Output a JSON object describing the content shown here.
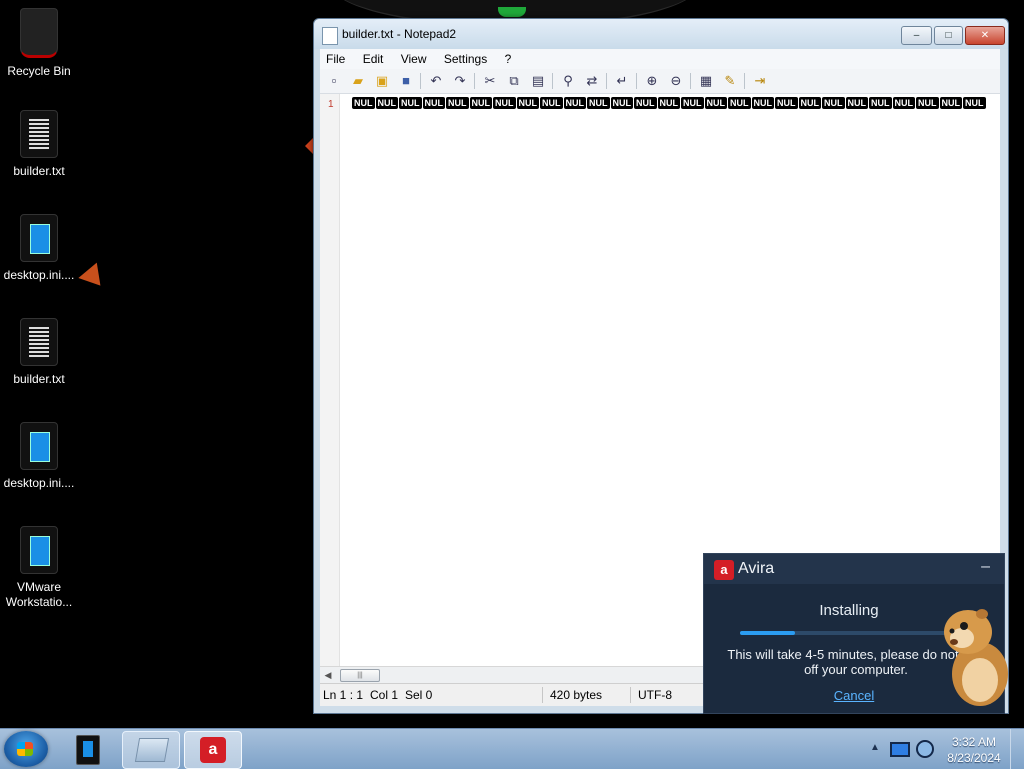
{
  "desktop": {
    "icons": [
      {
        "label": "Recycle Bin"
      },
      {
        "label": "builder.txt"
      },
      {
        "label": "desktop.ini...."
      },
      {
        "label": "builder.txt"
      },
      {
        "label": "desktop.ini...."
      },
      {
        "label": "VMware\nWorkstatio..."
      }
    ]
  },
  "notepad": {
    "title": "builder.txt - Notepad2",
    "window_buttons": {
      "minimize": "–",
      "maximize": "□",
      "close": "✕"
    },
    "menu": [
      "File",
      "Edit",
      "View",
      "Settings",
      "?"
    ],
    "toolbar_icons": [
      "new-icon",
      "open-icon",
      "browse-icon",
      "save-icon",
      "undo-icon",
      "redo-icon",
      "cut-icon",
      "copy-icon",
      "paste-icon",
      "find-icon",
      "replace-icon",
      "wordwrap-icon",
      "zoom-in-icon",
      "zoom-out-icon",
      "scheme-icon",
      "customize-icon",
      "exit-icon"
    ],
    "line_number": "1",
    "nul_token": "NUL",
    "nul_count": 27,
    "hscroll_thumb": "|||",
    "status": {
      "position": "Ln 1 : 1",
      "column": "Col 1",
      "selection": "Sel 0",
      "size": "420 bytes",
      "encoding": "UTF-8"
    }
  },
  "avira": {
    "title": "Avira",
    "logo_text": "a",
    "minimize": "–",
    "status": "Installing",
    "progress_percent": 26,
    "message": "This will take 4-5 minutes, please do not turn off your computer.",
    "cancel": "Cancel"
  },
  "taskbar": {
    "clock_time": "3:32 AM",
    "clock_date": "8/23/2024",
    "tray_arrow": "▲",
    "avira_task_text": "a"
  },
  "colors": {
    "avira_red": "#d41e26",
    "avira_bg": "#1b2a3e",
    "progress_blue": "#2b9cf1",
    "link_blue": "#5ab4ff"
  }
}
